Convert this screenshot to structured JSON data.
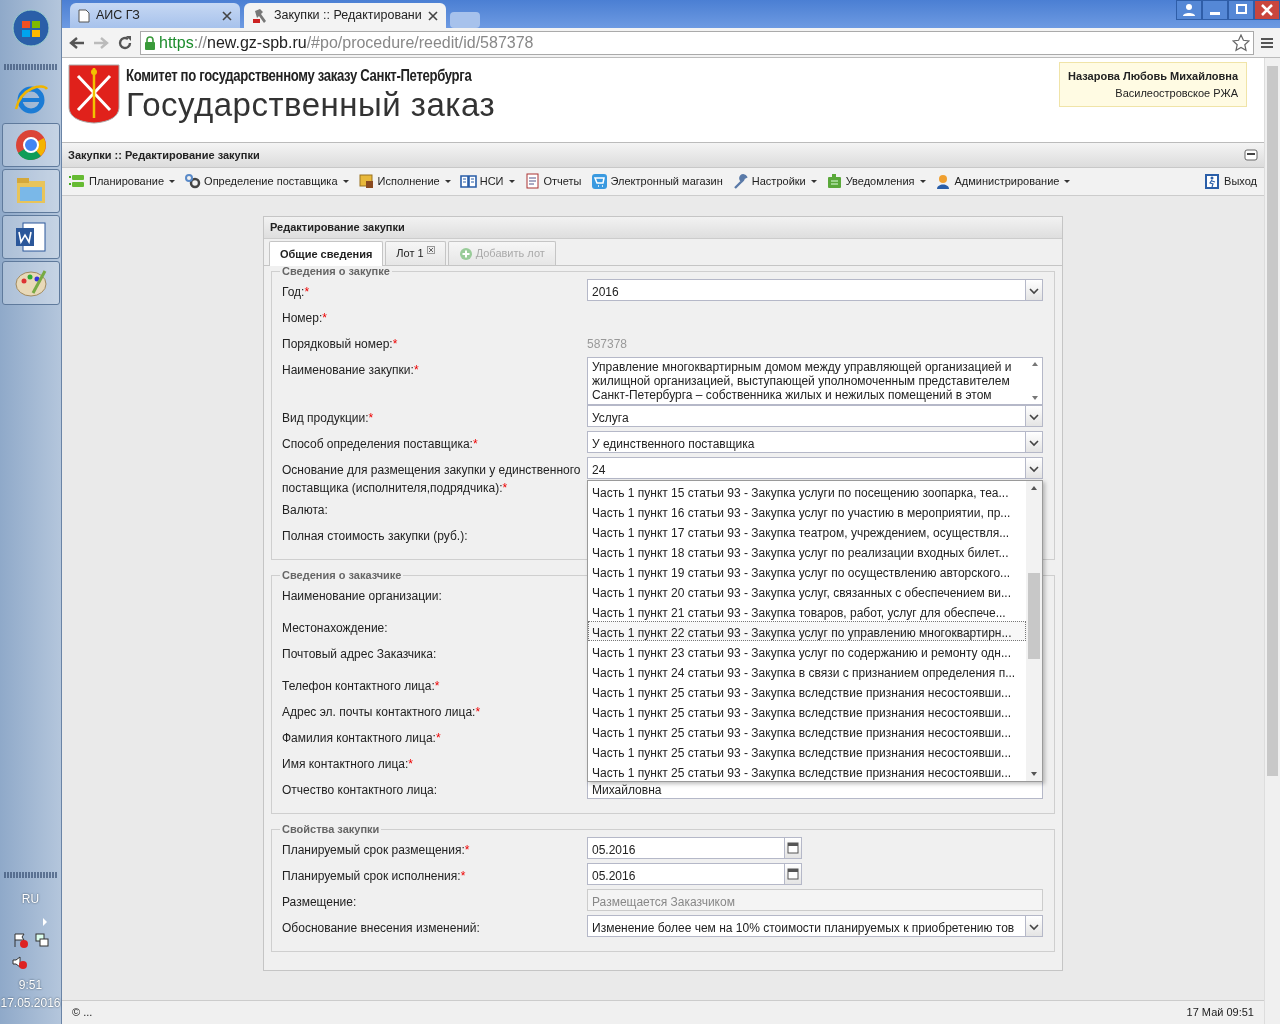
{
  "taskbar": {
    "language": "RU",
    "time": "9:51",
    "date": "17.05.2016"
  },
  "browser": {
    "tabs": [
      {
        "title": "АИС ГЗ",
        "selected": false
      },
      {
        "title": "Закупки :: Редактировани",
        "selected": true
      }
    ],
    "url": {
      "scheme": "https",
      "separator": "://",
      "host": "new.gz-spb.ru",
      "path": "/#po/procedure/reedit/id/587378"
    }
  },
  "header": {
    "committee": "Комитет по государственному заказу Санкт-Петербурга",
    "title": "Государственный заказ",
    "user": {
      "name": "Назарова Любовь Михайловна",
      "department": "Василеостровское РЖА"
    }
  },
  "panel_title": "Закупки :: Редактирование закупки",
  "toolbar": [
    {
      "label": "Планирование",
      "has_menu": true
    },
    {
      "label": "Определение поставщика",
      "has_menu": true
    },
    {
      "label": "Исполнение",
      "has_menu": true
    },
    {
      "label": "НСИ",
      "has_menu": true
    },
    {
      "label": "Отчеты",
      "has_menu": false
    },
    {
      "label": "Электронный магазин",
      "has_menu": false
    },
    {
      "label": "Настройки",
      "has_menu": true
    },
    {
      "label": "Уведомления",
      "has_menu": true
    },
    {
      "label": "Администрирование",
      "has_menu": true
    }
  ],
  "exit_label": "Выход",
  "form": {
    "title": "Редактирование закупки",
    "tabs": [
      {
        "label": "Общие сведения",
        "kind": "tab",
        "selected": true,
        "disabled": false
      },
      {
        "label": "Лот 1",
        "kind": "closable",
        "selected": false,
        "disabled": false
      },
      {
        "label": "Добавить лот",
        "kind": "add",
        "selected": false,
        "disabled": true
      }
    ],
    "sections": [
      {
        "legend": "Сведения о закупке",
        "fields": [
          {
            "label": "Год:",
            "required_mark": "*",
            "kind": "select",
            "value": "2016"
          },
          {
            "label": "Номер:",
            "required_mark": "*",
            "kind": "none"
          },
          {
            "label": "Порядковый номер:",
            "required_mark": "*",
            "kind": "static",
            "value": "587378"
          },
          {
            "label": "Наименование закупки:",
            "required_mark": "*",
            "kind": "textarea",
            "value": "Управление многоквартирным домом между управляющей организацией и жилищной организацией, выступающей уполномоченным представителем Санкт-Петербурга – собственника жилых и нежилых помещений в этом"
          },
          {
            "label": "Вид продукции:",
            "required_mark": "*",
            "kind": "select",
            "value": "Услуга"
          },
          {
            "label": "Способ определения поставщика:",
            "required_mark": "*",
            "kind": "select",
            "value": "У единственного поставщика"
          },
          {
            "label": "Основание для размещения закупки у единственного поставщика (исполнителя,подрядчика):",
            "required_mark": "*",
            "kind": "select",
            "value": "24",
            "expanded": true,
            "options": [
              {
                "text": "Часть 1 пункт 15 статьи 93 - Закупка услуги по посещению зоопарка, теа...",
                "selected": false
              },
              {
                "text": "Часть 1 пункт 16 статьи 93 - Закупка услуг по участию в мероприятии, пр...",
                "selected": false
              },
              {
                "text": "Часть 1 пункт 17 статьи 93 - Закупка театром, учреждением, осуществля...",
                "selected": false
              },
              {
                "text": "Часть 1 пункт 18 статьи 93 - Закупка услуг по реализации входных билет...",
                "selected": false
              },
              {
                "text": "Часть 1 пункт 19 статьи 93 - Закупка услуг по осуществлению авторского...",
                "selected": false
              },
              {
                "text": "Часть 1 пункт 20 статьи 93 - Закупка услуг, связанных с обеспечением ви...",
                "selected": false
              },
              {
                "text": "Часть 1 пункт 21 статьи 93 - Закупка товаров, работ, услуг для обеспече...",
                "selected": false
              },
              {
                "text": "Часть 1 пункт 22 статьи 93 - Закупка услуг по управлению многоквартирн...",
                "selected": true
              },
              {
                "text": "Часть 1 пункт 23 статьи 93 - Закупка услуг по содержанию и ремонту одн...",
                "selected": false
              },
              {
                "text": "Часть 1 пункт 24 статьи 93 - Закупка в связи с признанием определения п...",
                "selected": false
              },
              {
                "text": "Часть 1 пункт 25 статьи 93 - Закупка вследствие признания несостоявши...",
                "selected": false
              },
              {
                "text": "Часть 1 пункт 25 статьи 93 - Закупка вследствие признания несостоявши...",
                "selected": false
              },
              {
                "text": "Часть 1 пункт 25 статьи 93 - Закупка вследствие признания несостоявши...",
                "selected": false
              },
              {
                "text": "Часть 1 пункт 25 статьи 93 - Закупка вследствие признания несостоявши...",
                "selected": false
              },
              {
                "text": "Часть 1 пункт 25 статьи 93 - Закупка вследствие признания несостоявши...",
                "selected": false
              }
            ]
          },
          {
            "label": "Валюта:",
            "kind": "none"
          },
          {
            "label": "Полная стоимость закупки (руб.):",
            "kind": "none"
          }
        ]
      },
      {
        "legend": "Сведения о заказчике",
        "fields": [
          {
            "label": "Наименование организации:",
            "kind": "none",
            "tall": true
          },
          {
            "label": "Местонахождение:",
            "kind": "none"
          },
          {
            "label": "Почтовый адрес Заказчика:",
            "kind": "none",
            "tall": true
          },
          {
            "label": "Телефон контактного лица:",
            "required_mark": "*",
            "kind": "none"
          },
          {
            "label": "Адрес эл. почты контактного лица:",
            "required_mark": "*",
            "kind": "none"
          },
          {
            "label": "Фамилия контактного лица:",
            "required_mark": "*",
            "kind": "none"
          },
          {
            "label": "Имя контактного лица:",
            "required_mark": "*",
            "kind": "none"
          },
          {
            "label": "Отчество контактного лица:",
            "kind": "text",
            "value": "Михайловна"
          }
        ]
      },
      {
        "legend": "Свойства закупки",
        "fields": [
          {
            "label": "Планируемый срок размещения:",
            "required_mark": "*",
            "kind": "date",
            "value": "05.2016"
          },
          {
            "label": "Планируемый срок исполнения:",
            "required_mark": "*",
            "kind": "date",
            "value": "05.2016"
          },
          {
            "label": "Размещение:",
            "kind": "text",
            "value": "Размещается Заказчиком",
            "disabled": true
          },
          {
            "label": "Обоснование внесения изменений:",
            "kind": "select",
            "value": "Изменение более чем на 10% стоимости планируемых к приобретению тов"
          }
        ]
      }
    ]
  },
  "status_bar": {
    "left": "© ...",
    "right": "17 Май 09:51"
  }
}
